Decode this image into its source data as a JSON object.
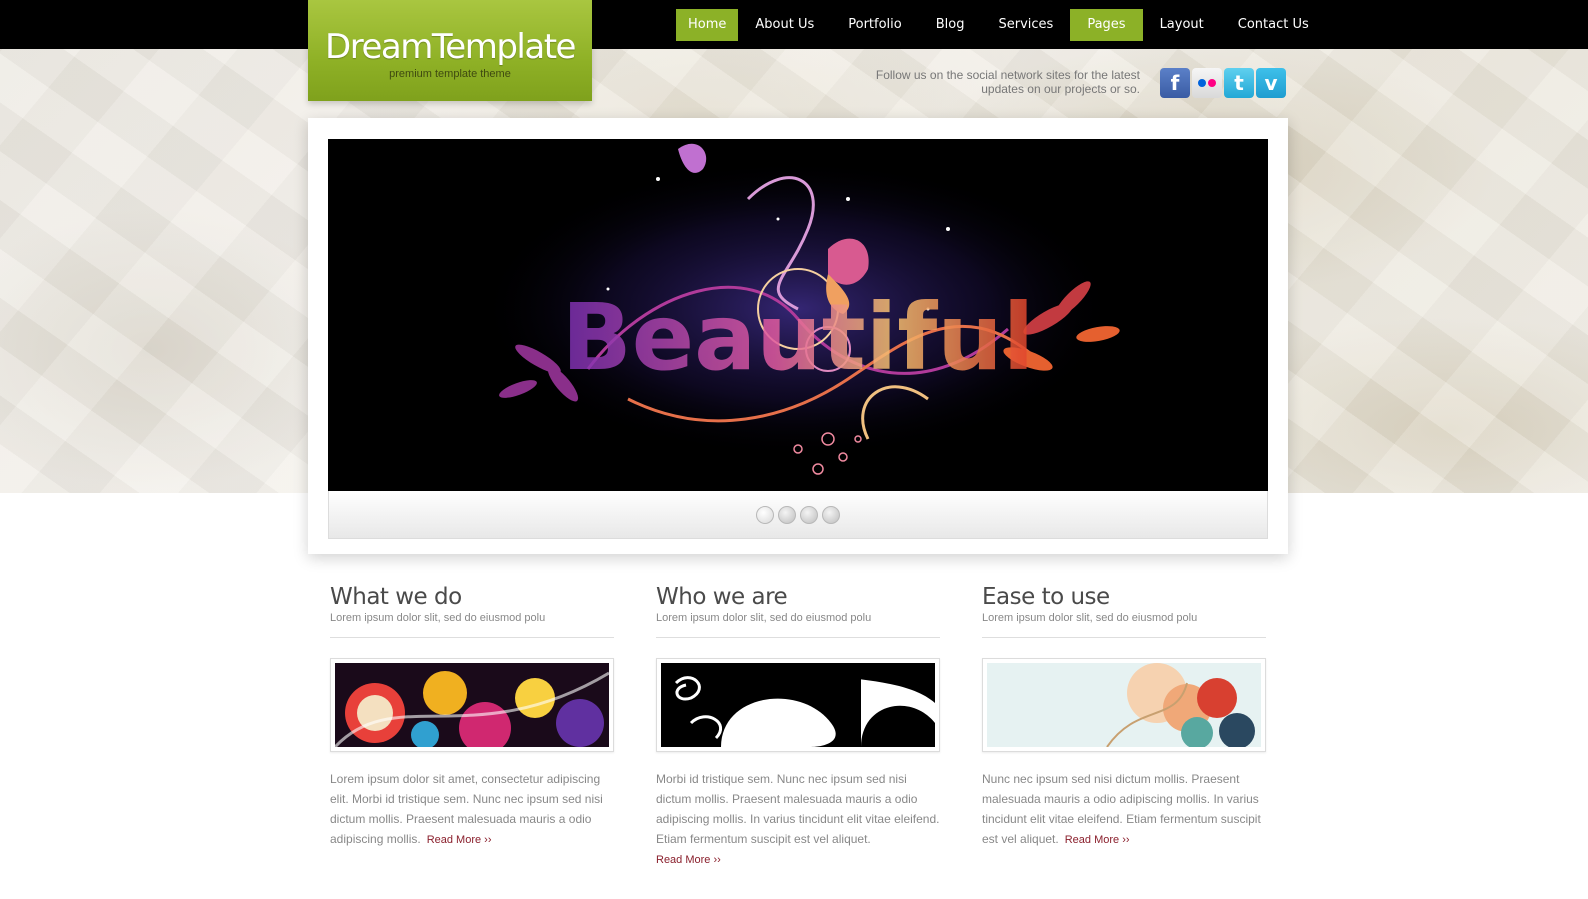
{
  "logo": {
    "title": "DreamTemplate",
    "subtitle": "premium template theme"
  },
  "nav": {
    "items": [
      {
        "label": "Home",
        "active": true
      },
      {
        "label": "About Us",
        "active": false
      },
      {
        "label": "Portfolio",
        "active": false
      },
      {
        "label": "Blog",
        "active": false
      },
      {
        "label": "Services",
        "active": false
      },
      {
        "label": "Pages",
        "active": true
      },
      {
        "label": "Layout",
        "active": false
      },
      {
        "label": "Contact Us",
        "active": false
      }
    ]
  },
  "social": {
    "text_line1": "Follow us on the social network sites for the latest",
    "text_line2": "updates on our projects or so.",
    "icons": [
      "facebook-icon",
      "flickr-icon",
      "twitter-icon",
      "vimeo-icon"
    ]
  },
  "slider": {
    "pager_count": 4,
    "slide_text": "Beautiful"
  },
  "columns": [
    {
      "title": "What we do",
      "subtitle": "Lorem ipsum dolor slit, sed do eiusmod polu",
      "body": "Lorem ipsum dolor sit amet, consectetur adipiscing elit. Morbi id tristique sem. Nunc nec ipsum sed nisi dictum mollis. Praesent malesuada mauris a odio adipiscing mollis.",
      "read_more": "Read More ››"
    },
    {
      "title": "Who we are",
      "subtitle": "Lorem ipsum dolor slit, sed do eiusmod polu",
      "body": "Morbi id tristique sem. Nunc nec ipsum sed nisi dictum mollis. Praesent malesuada mauris a odio adipiscing mollis. In varius tincidunt elit vitae eleifend. Etiam fermentum suscipit est vel aliquet.",
      "read_more": "Read More ››"
    },
    {
      "title": "Ease to use",
      "subtitle": "Lorem ipsum dolor slit, sed do eiusmod polu",
      "body": "Nunc nec ipsum sed nisi dictum mollis. Praesent malesuada mauris a odio adipiscing mollis. In varius tincidunt elit vitae eleifend. Etiam fermentum suscipit est vel aliquet.",
      "read_more": "Read More ››"
    }
  ],
  "colors": {
    "accent": "#8cb127",
    "topbar": "#000000",
    "read_more": "#8a1f2c",
    "text_gray": "#888888"
  }
}
